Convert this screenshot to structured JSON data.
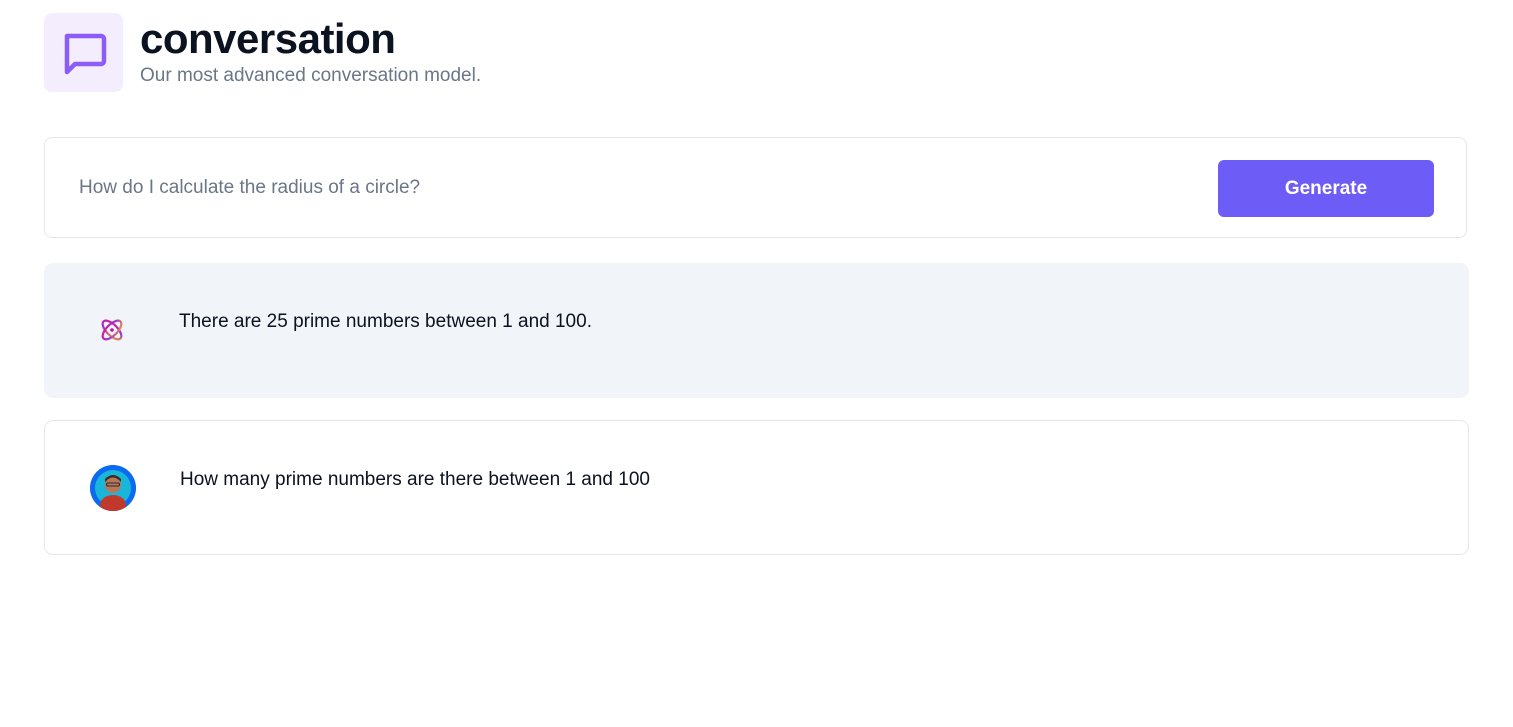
{
  "header": {
    "icon": "chat-bubble-icon",
    "title": "conversation",
    "subtitle": "Our most advanced conversation model."
  },
  "prompt": {
    "placeholder": "How do I calculate the radius of a circle?",
    "value": "",
    "generate_label": "Generate"
  },
  "messages": [
    {
      "role": "bot",
      "avatar_icon": "ai-logo-icon",
      "text": "There are 25 prime numbers between 1 and 100."
    },
    {
      "role": "user",
      "avatar_icon": "user-avatar",
      "text": "How many prime numbers are there between 1 and 100"
    }
  ],
  "colors": {
    "accent": "#6e5cf6",
    "header_icon_bg": "#f3edfd",
    "header_icon_stroke": "#8b5cf6",
    "bot_bg": "#f1f4f9",
    "muted_text": "#6b7686",
    "border": "#e5e7eb"
  }
}
